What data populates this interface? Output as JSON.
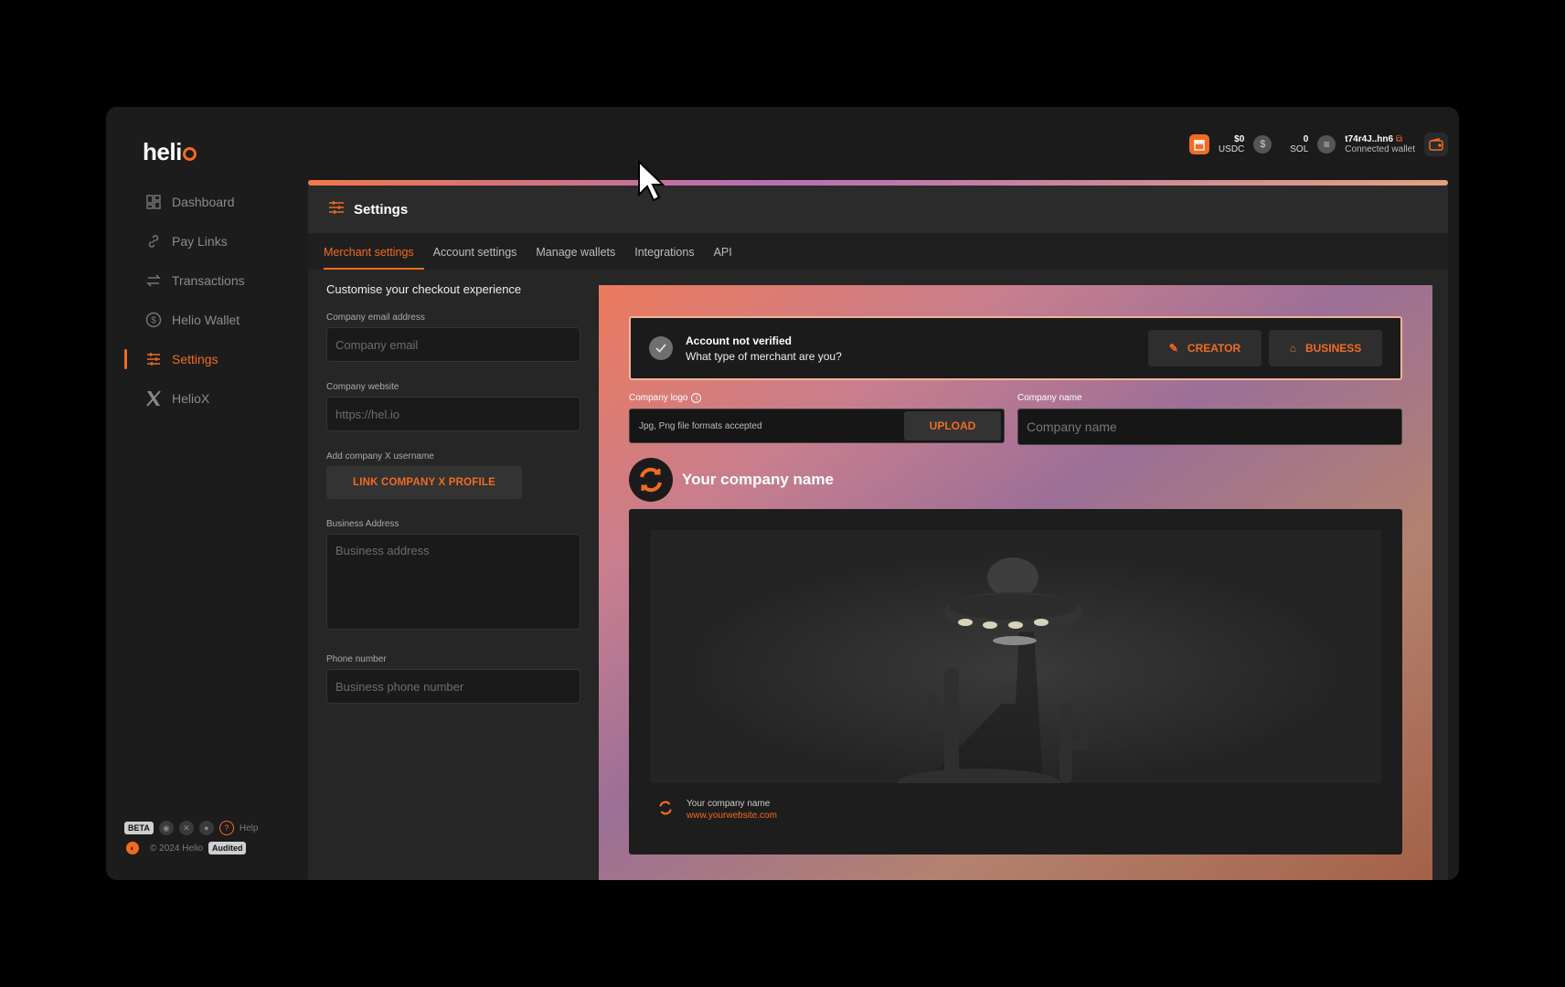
{
  "brand": {
    "name": "heli"
  },
  "nav": [
    {
      "label": "Dashboard",
      "icon": "dashboard-icon"
    },
    {
      "label": "Pay Links",
      "icon": "link-icon"
    },
    {
      "label": "Transactions",
      "icon": "transfer-icon"
    },
    {
      "label": "Helio Wallet",
      "icon": "dollar-coin-icon"
    },
    {
      "label": "Settings",
      "icon": "sliders-icon",
      "active": true
    },
    {
      "label": "HelioX",
      "icon": "x-logo-icon"
    }
  ],
  "footer": {
    "beta": "BETA",
    "help": "Help",
    "copyright": "© 2024 Helio",
    "audited": "Audited"
  },
  "topbar": {
    "usdc_amount": "$0",
    "usdc_label": "USDC",
    "sol_amount": "0",
    "sol_label": "SOL",
    "wallet_address": "t74r4J..hn6",
    "wallet_label": "Connected wallet"
  },
  "page": {
    "title": "Settings",
    "tabs": [
      "Merchant settings",
      "Account settings",
      "Manage wallets",
      "Integrations",
      "API"
    ],
    "active_tab": "Merchant settings"
  },
  "form": {
    "heading": "Customise your checkout experience",
    "email_label": "Company email address",
    "email_placeholder": "Company email",
    "website_label": "Company website",
    "website_placeholder": "https://hel.io",
    "x_label": "Add company X username",
    "x_button": "LINK COMPANY X PROFILE",
    "address_label": "Business Address",
    "address_placeholder": "Business address",
    "phone_label": "Phone number",
    "phone_placeholder": "Business phone number"
  },
  "preview": {
    "verify_title": "Account not verified",
    "verify_question": "What type of merchant are you?",
    "creator_button": "CREATOR",
    "business_button": "BUSINESS",
    "logo_label": "Company logo",
    "logo_hint": "Jpg, Png file formats accepted",
    "upload_button": "UPLOAD",
    "name_label": "Company name",
    "name_placeholder": "Company name",
    "company_display": "Your company name",
    "card_company": "Your company name",
    "card_website": "www.yourwebsite.com"
  },
  "colors": {
    "accent": "#f26b21",
    "background": "#1b1b1b"
  }
}
